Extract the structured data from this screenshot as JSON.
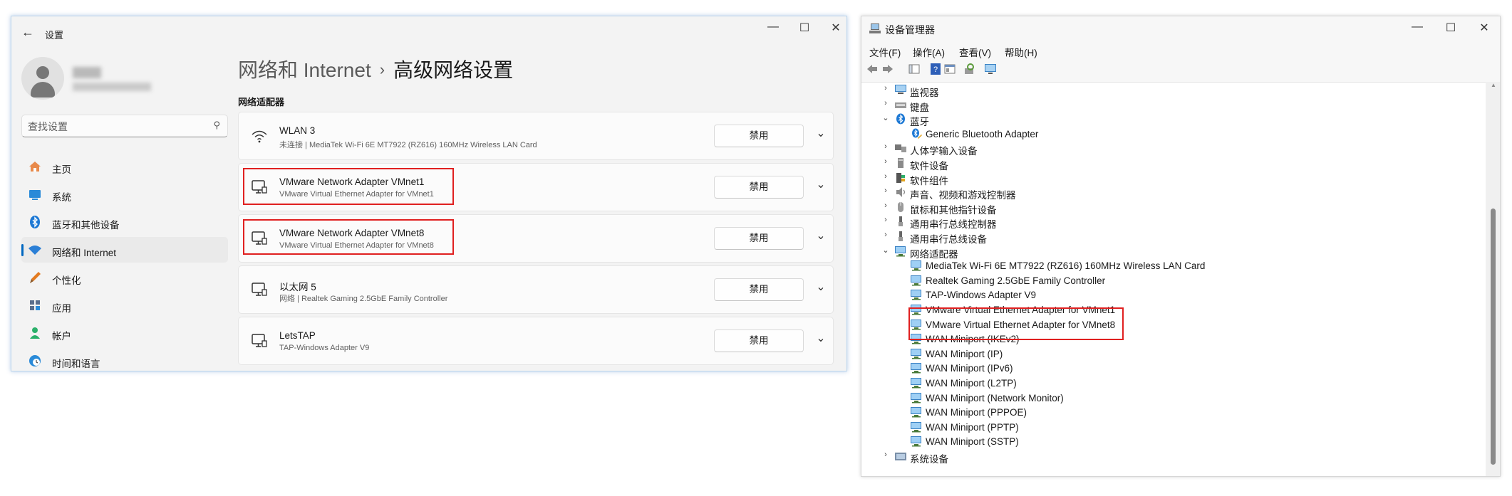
{
  "settings": {
    "app_title": "设置",
    "breadcrumb_parent": "网络和 Internet",
    "breadcrumb_sep": "›",
    "breadcrumb_current": "高级网络设置",
    "search_placeholder": "查找设置",
    "section_title": "网络适配器",
    "nav": [
      {
        "label": "主页",
        "icon": "home-icon"
      },
      {
        "label": "系统",
        "icon": "system-icon"
      },
      {
        "label": "蓝牙和其他设备",
        "icon": "bluetooth-icon"
      },
      {
        "label": "网络和 Internet",
        "icon": "wifi-icon",
        "active": true
      },
      {
        "label": "个性化",
        "icon": "brush-icon"
      },
      {
        "label": "应用",
        "icon": "apps-icon"
      },
      {
        "label": "帐户",
        "icon": "account-icon"
      },
      {
        "label": "时间和语言",
        "icon": "globe-clock-icon"
      }
    ],
    "adapters": [
      {
        "name": "WLAN 3",
        "desc": "未连接 | MediaTek Wi-Fi 6E MT7922 (RZ616) 160MHz Wireless LAN Card",
        "button": "禁用",
        "icon": "wifi-icon"
      },
      {
        "name": "VMware Network Adapter VMnet1",
        "desc": "VMware Virtual Ethernet Adapter for VMnet1",
        "button": "禁用",
        "icon": "ethernet-icon"
      },
      {
        "name": "VMware Network Adapter VMnet8",
        "desc": "VMware Virtual Ethernet Adapter for VMnet8",
        "button": "禁用",
        "icon": "ethernet-icon"
      },
      {
        "name": "以太网 5",
        "desc": "网络 | Realtek Gaming 2.5GbE Family Controller",
        "button": "禁用",
        "icon": "ethernet-icon"
      },
      {
        "name": "LetsTAP",
        "desc": "TAP-Windows Adapter V9",
        "button": "禁用",
        "icon": "ethernet-icon"
      }
    ],
    "highlight_color": "#e02020"
  },
  "devmgr": {
    "title": "设备管理器",
    "menu": [
      "文件(F)",
      "操作(A)",
      "查看(V)",
      "帮助(H)"
    ],
    "tree": [
      {
        "label": "监视器",
        "level": 1,
        "expander": "›",
        "icon": "monitor-icon"
      },
      {
        "label": "键盘",
        "level": 1,
        "expander": "›",
        "icon": "keyboard-icon"
      },
      {
        "label": "蓝牙",
        "level": 1,
        "expander": "⌄",
        "icon": "bluetooth-icon"
      },
      {
        "label": "Generic Bluetooth Adapter",
        "level": 2,
        "expander": "",
        "icon": "bluetooth-device-icon"
      },
      {
        "label": "人体学输入设备",
        "level": 1,
        "expander": "›",
        "icon": "hid-icon"
      },
      {
        "label": "软件设备",
        "level": 1,
        "expander": "›",
        "icon": "software-device-icon"
      },
      {
        "label": "软件组件",
        "level": 1,
        "expander": "›",
        "icon": "software-component-icon"
      },
      {
        "label": "声音、视频和游戏控制器",
        "level": 1,
        "expander": "›",
        "icon": "speaker-icon"
      },
      {
        "label": "鼠标和其他指针设备",
        "level": 1,
        "expander": "›",
        "icon": "mouse-icon"
      },
      {
        "label": "通用串行总线控制器",
        "level": 1,
        "expander": "›",
        "icon": "usb-icon"
      },
      {
        "label": "通用串行总线设备",
        "level": 1,
        "expander": "›",
        "icon": "usb-icon"
      },
      {
        "label": "网络适配器",
        "level": 1,
        "expander": "⌄",
        "icon": "network-adapter-icon"
      },
      {
        "label": "MediaTek Wi-Fi 6E MT7922 (RZ616) 160MHz Wireless LAN Card",
        "level": 2,
        "expander": "",
        "icon": "network-adapter-icon"
      },
      {
        "label": "Realtek Gaming 2.5GbE Family Controller",
        "level": 2,
        "expander": "",
        "icon": "network-adapter-icon"
      },
      {
        "label": "TAP-Windows Adapter V9",
        "level": 2,
        "expander": "",
        "icon": "network-adapter-icon"
      },
      {
        "label": "VMware Virtual Ethernet Adapter for VMnet1",
        "level": 2,
        "expander": "",
        "icon": "network-adapter-icon"
      },
      {
        "label": "VMware Virtual Ethernet Adapter for VMnet8",
        "level": 2,
        "expander": "",
        "icon": "network-adapter-icon"
      },
      {
        "label": "WAN Miniport (IKEv2)",
        "level": 2,
        "expander": "",
        "icon": "network-adapter-icon"
      },
      {
        "label": "WAN Miniport (IP)",
        "level": 2,
        "expander": "",
        "icon": "network-adapter-icon"
      },
      {
        "label": "WAN Miniport (IPv6)",
        "level": 2,
        "expander": "",
        "icon": "network-adapter-icon"
      },
      {
        "label": "WAN Miniport (L2TP)",
        "level": 2,
        "expander": "",
        "icon": "network-adapter-icon"
      },
      {
        "label": "WAN Miniport (Network Monitor)",
        "level": 2,
        "expander": "",
        "icon": "network-adapter-icon"
      },
      {
        "label": "WAN Miniport (PPPOE)",
        "level": 2,
        "expander": "",
        "icon": "network-adapter-icon"
      },
      {
        "label": "WAN Miniport (PPTP)",
        "level": 2,
        "expander": "",
        "icon": "network-adapter-icon"
      },
      {
        "label": "WAN Miniport (SSTP)",
        "level": 2,
        "expander": "",
        "icon": "network-adapter-icon"
      },
      {
        "label": "系统设备",
        "level": 1,
        "expander": "›",
        "icon": "system-device-icon"
      }
    ]
  }
}
